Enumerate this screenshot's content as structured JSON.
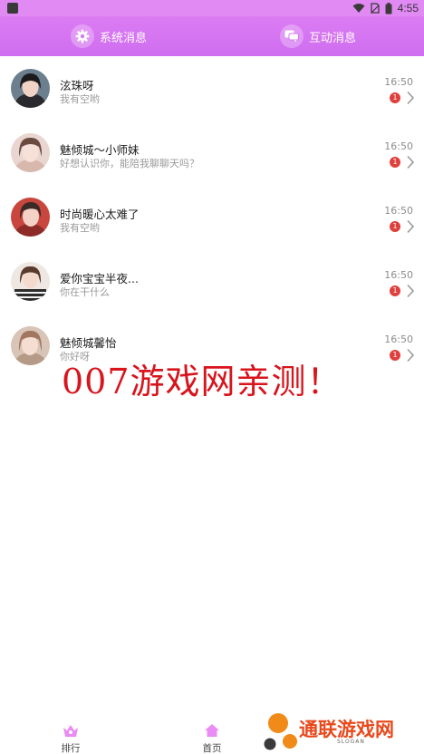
{
  "status_bar": {
    "time": "4:55"
  },
  "header": {
    "tabs": [
      {
        "label": "系统消息",
        "icon": "gear-icon"
      },
      {
        "label": "互动消息",
        "icon": "chat-bubbles-icon"
      }
    ]
  },
  "messages": [
    {
      "name": "泫珠呀",
      "preview": "我有空哟",
      "time": "16:50",
      "unread": "1"
    },
    {
      "name": "魅倾城～小师妹",
      "preview": "好想认识你，能陪我聊聊天吗？",
      "time": "16:50",
      "unread": "1"
    },
    {
      "name": "时尚暖心太难了",
      "preview": "我有空哟",
      "time": "16:50",
      "unread": "1"
    },
    {
      "name": "爱你宝宝半夜...",
      "preview": "你在干什么",
      "time": "16:50",
      "unread": "1"
    },
    {
      "name": "魅倾城馨怡",
      "preview": "你好呀",
      "time": "16:50",
      "unread": "1"
    }
  ],
  "overlay": {
    "text": "007游戏网亲测！"
  },
  "bottom_nav": {
    "items": [
      {
        "label": "排行",
        "icon": "crown-icon"
      },
      {
        "label": "首页",
        "icon": "home-icon"
      }
    ]
  },
  "logo": {
    "text": "通联游戏网",
    "slogan": "SLOGAN"
  },
  "colors": {
    "header": "#d876f2",
    "badge": "#e0403d",
    "overlay": "#d8141c",
    "logo": "#e8491c"
  }
}
